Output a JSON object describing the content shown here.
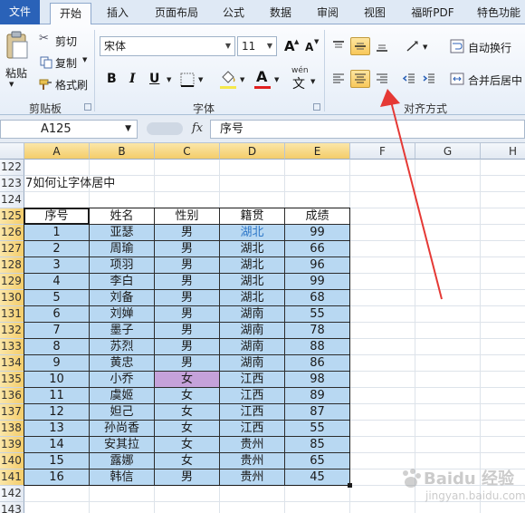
{
  "ribbon_tabs": [
    "文件",
    "开始",
    "插入",
    "页面布局",
    "公式",
    "数据",
    "审阅",
    "视图",
    "福昕PDF",
    "特色功能"
  ],
  "clipboard": {
    "paste": "粘贴",
    "cut": "剪切",
    "copy": "复制",
    "format_painter": "格式刷",
    "group_label": "剪贴板"
  },
  "font": {
    "name": "宋体",
    "size": "11",
    "bold": "B",
    "italic": "I",
    "underline": "U",
    "phonetic": "wén",
    "phonetic_char": "文",
    "grow": "A",
    "shrink": "A",
    "group_label": "字体"
  },
  "alignment": {
    "wrap_text": "自动换行",
    "merge_center": "合并后居中",
    "group_label": "对齐方式",
    "selected": [
      "top-middle",
      "center"
    ]
  },
  "formula_bar": {
    "name_box": "A125",
    "fx": "fx",
    "content": "序号"
  },
  "columns": [
    "A",
    "B",
    "C",
    "D",
    "E",
    "F",
    "G",
    "H"
  ],
  "rows": [
    "122",
    "123",
    "124",
    "125",
    "126",
    "127",
    "128",
    "129",
    "130",
    "131",
    "132",
    "133",
    "134",
    "135",
    "136",
    "137",
    "138",
    "139",
    "140",
    "141",
    "142",
    "143"
  ],
  "sheet_title": "7如何让字体居中",
  "table": {
    "headers": [
      "序号",
      "姓名",
      "性别",
      "籍贯",
      "成绩"
    ],
    "rows": [
      [
        "1",
        "亚瑟",
        "男",
        "湖北",
        "99"
      ],
      [
        "2",
        "周瑜",
        "男",
        "湖北",
        "66"
      ],
      [
        "3",
        "项羽",
        "男",
        "湖北",
        "96"
      ],
      [
        "4",
        "李白",
        "男",
        "湖北",
        "99"
      ],
      [
        "5",
        "刘备",
        "男",
        "湖北",
        "68"
      ],
      [
        "6",
        "刘婵",
        "男",
        "湖南",
        "55"
      ],
      [
        "7",
        "墨子",
        "男",
        "湖南",
        "78"
      ],
      [
        "8",
        "苏烈",
        "男",
        "湖南",
        "88"
      ],
      [
        "9",
        "黄忠",
        "男",
        "湖南",
        "86"
      ],
      [
        "10",
        "小乔",
        "女",
        "江西",
        "98"
      ],
      [
        "11",
        "虞姬",
        "女",
        "江西",
        "89"
      ],
      [
        "12",
        "妲己",
        "女",
        "江西",
        "87"
      ],
      [
        "13",
        "孙尚香",
        "女",
        "江西",
        "55"
      ],
      [
        "14",
        "安其拉",
        "女",
        "贵州",
        "85"
      ],
      [
        "15",
        "露娜",
        "女",
        "贵州",
        "65"
      ],
      [
        "16",
        "韩信",
        "男",
        "贵州",
        "45"
      ]
    ]
  },
  "watermark": {
    "line1": "Baidu 经验",
    "line2": "jingyan.baidu.com"
  },
  "colors": {
    "file_tab": "#2a62b8",
    "table_fill": "#b8d8f2",
    "highlight_cell": "#c5a2da",
    "annotation_arrow": "#e53935",
    "selected_button": "#f8c85a"
  }
}
